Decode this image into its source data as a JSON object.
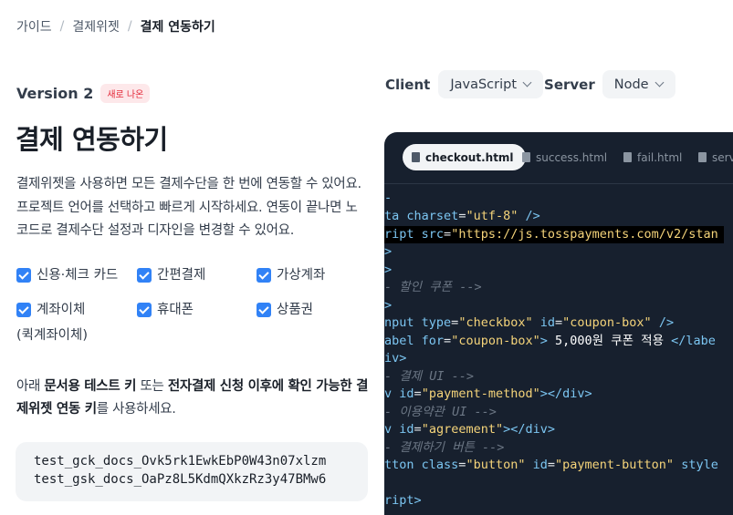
{
  "breadcrumb": {
    "items": [
      "가이드",
      "결제위젯"
    ],
    "current": "결제 연동하기",
    "separator": "/"
  },
  "version": {
    "label": "Version 2",
    "badge": "새로 나온"
  },
  "title": "결제 연동하기",
  "description": "결제위젯을 사용하면 모든 결제수단을 한 번에 연동할 수 있어요. 프로젝트 언어를 선택하고 빠르게 시작하세요. 연동이 끝나면 노코드로 결제수단 설정과 디자인을 변경할 수 있어요.",
  "payment_methods": [
    {
      "label": "신용·체크 카드",
      "checked": true
    },
    {
      "label": "간편결제",
      "checked": true
    },
    {
      "label": "가상계좌",
      "checked": true
    },
    {
      "label": "계좌이체",
      "checked": true
    },
    {
      "label": "휴대폰",
      "checked": true
    },
    {
      "label": "상품권",
      "checked": true
    }
  ],
  "payment_method_note": "(퀵계좌이체)",
  "key_intro": {
    "p1": "아래 ",
    "b1": "문서용 테스트 키",
    "p2": " 또는 ",
    "b2": "전자결제 신청 이후에 확인 가능한 결제위젯 연동 키",
    "p3": "를 사용하세요."
  },
  "keys": [
    "test_gck_docs_Ovk5rk1EwkEbP0W43n07xlzm",
    "test_gsk_docs_OaPz8L5KdmQXkzRz3y47BMw6"
  ],
  "client": {
    "label": "Client",
    "value": "JavaScript"
  },
  "server": {
    "label": "Server",
    "value": "Node"
  },
  "editor": {
    "tabs": [
      "checkout.html",
      "success.html",
      "fail.html",
      "serv"
    ],
    "active_tab": "checkout.html"
  },
  "colors": {
    "accent": "#3182f6",
    "editor_bg": "#17202e",
    "badge_bg": "#fde8ea",
    "badge_text": "#e42939"
  }
}
